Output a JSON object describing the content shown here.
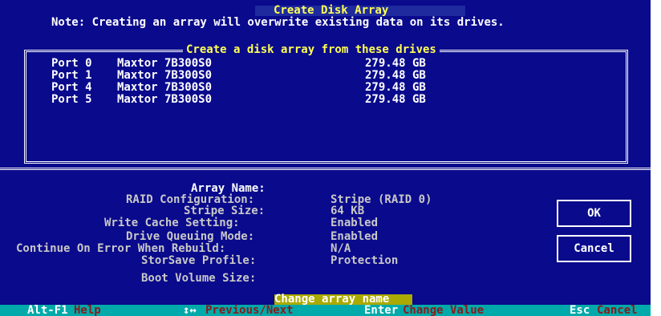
{
  "dialog": {
    "title": "Create Disk Array",
    "note": "Note: Creating an array will overwrite existing data on its drives."
  },
  "drive_list": {
    "title": "Create a disk array from these drives",
    "items": [
      {
        "port": "Port 0",
        "model": "Maxtor 7B300S0",
        "size": "279.48 GB"
      },
      {
        "port": "Port 1",
        "model": "Maxtor 7B300S0",
        "size": "279.48 GB"
      },
      {
        "port": "Port 4",
        "model": "Maxtor 7B300S0",
        "size": "279.48 GB"
      },
      {
        "port": "Port 5",
        "model": "Maxtor 7B300S0",
        "size": "279.48 GB"
      }
    ]
  },
  "settings": {
    "array_name": {
      "label": "Array Name:",
      "value": ""
    },
    "raid_configuration": {
      "label": "RAID Configuration:",
      "value": "Stripe (RAID 0)"
    },
    "stripe_size": {
      "label": "Stripe Size:",
      "value": "64 KB"
    },
    "write_cache": {
      "label": "Write Cache Setting:",
      "value": "Enabled"
    },
    "drive_queuing": {
      "label": "Drive Queuing Mode:",
      "value": "Enabled"
    },
    "continue_on_error": {
      "label": "Continue On Error When Rebuild:",
      "value": "N/A"
    },
    "storsave_profile": {
      "label": "StorSave Profile:",
      "value": "Protection"
    },
    "boot_volume_size": {
      "label": "Boot Volume Size:",
      "value": ""
    }
  },
  "buttons": {
    "ok": "OK",
    "cancel": "Cancel"
  },
  "status": {
    "message": "Change array name"
  },
  "footer": {
    "help_key": "Alt-F1",
    "help_label": "Help",
    "nav_key": "↕↔",
    "nav_label": "Previous/Next",
    "enter_key": "Enter",
    "enter_label": "Change Value",
    "esc_key": "Esc",
    "esc_label": "Cancel"
  },
  "colors": {
    "background": "#0a0a8c",
    "highlight": "#ffff55",
    "footer_bar": "#00aaaa",
    "status_highlight": "#aaaa00"
  }
}
